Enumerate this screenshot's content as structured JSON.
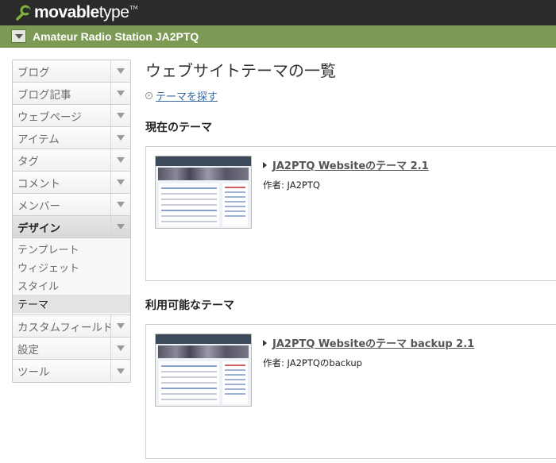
{
  "app": {
    "logo_text_bold": "movable",
    "logo_text_light": "type",
    "logo_tm": "TM"
  },
  "blog": {
    "name": "Amateur Radio Station JA2PTQ"
  },
  "sidebar": {
    "items": [
      {
        "label": "ブログ"
      },
      {
        "label": "ブログ記事"
      },
      {
        "label": "ウェブページ"
      },
      {
        "label": "アイテム"
      },
      {
        "label": "タグ"
      },
      {
        "label": "コメント"
      },
      {
        "label": "メンバー"
      },
      {
        "label": "デザイン"
      },
      {
        "label": "カスタムフィールド"
      },
      {
        "label": "設定"
      },
      {
        "label": "ツール"
      }
    ],
    "design_sub": [
      {
        "label": "テンプレート"
      },
      {
        "label": "ウィジェット"
      },
      {
        "label": "スタイル"
      },
      {
        "label": "テーマ"
      }
    ]
  },
  "main": {
    "title": "ウェブサイトテーマの一覧",
    "find_link": "テーマを探す",
    "current_section": "現在のテーマ",
    "available_section": "利用可能なテーマ",
    "current_theme": {
      "name": "JA2PTQ Websiteのテーマ 2.1",
      "author": "作者: JA2PTQ"
    },
    "available_theme": {
      "name": "JA2PTQ Websiteのテーマ backup 2.1",
      "author": "作者: JA2PTQのbackup"
    }
  },
  "colors": {
    "topbar": "#2b2b2b",
    "blogbar": "#7c9a53",
    "link": "#3b6a9c"
  }
}
